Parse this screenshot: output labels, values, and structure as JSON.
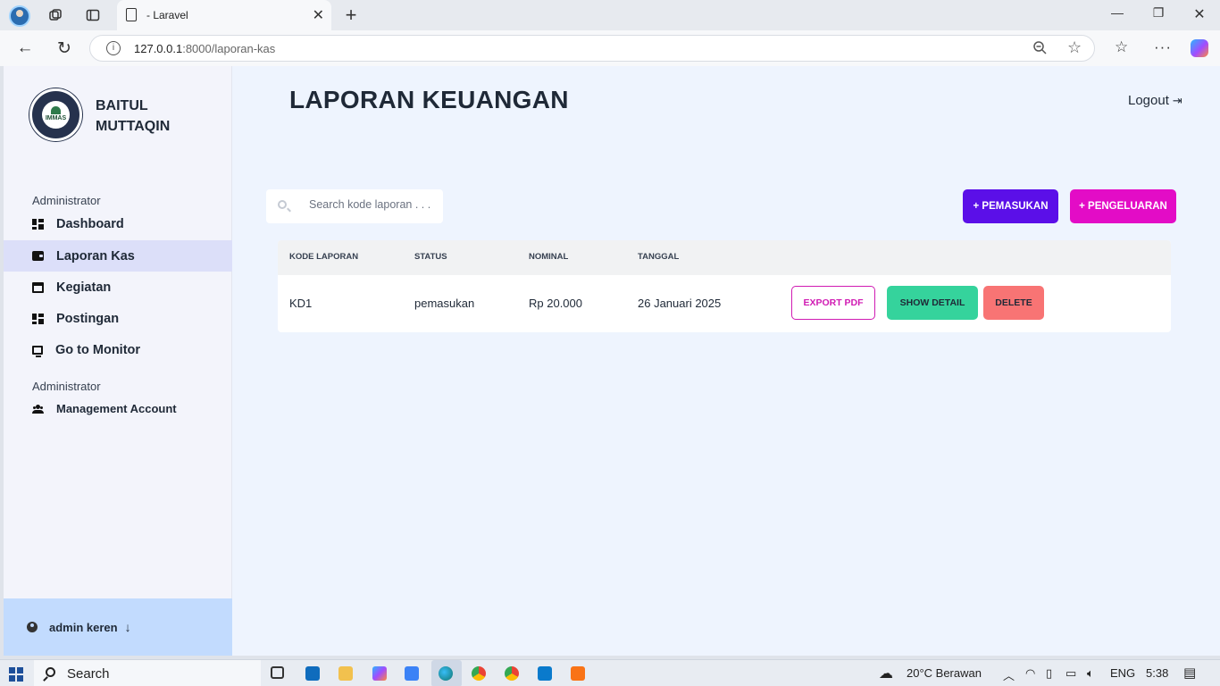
{
  "browser": {
    "tab_title": "- Laravel",
    "url_host": "127.0.0.1",
    "url_rest": ":8000/laporan-kas"
  },
  "sidebar": {
    "brand_line1": "BAITUL",
    "brand_line2": "MUTTAQIN",
    "logo_text": "IMMAS",
    "section1": "Administrator",
    "items": [
      {
        "label": "Dashboard",
        "icon": "dashboard-icon"
      },
      {
        "label": "Laporan Kas",
        "icon": "wallet-icon",
        "active": true
      },
      {
        "label": "Kegiatan",
        "icon": "calendar-icon"
      },
      {
        "label": "Postingan",
        "icon": "dashboard-icon"
      },
      {
        "label": "Go to Monitor",
        "icon": "monitor-icon"
      }
    ],
    "section2": "Administrator",
    "account_item": {
      "label": "Management Account",
      "icon": "users-icon"
    },
    "user_name": "admin keren"
  },
  "header": {
    "title": "LAPORAN KEUANGAN",
    "logout_label": "Logout"
  },
  "toolbar": {
    "search_placeholder": "Search kode laporan . . .",
    "pemasukan_label": "+ PEMASUKAN",
    "pengeluaran_label": "+ PENGELUARAN"
  },
  "table": {
    "headers": [
      "KODE LAPORAN",
      "STATUS",
      "NOMINAL",
      "TANGGAL"
    ],
    "rows": [
      {
        "kode": "KD1",
        "status": "pemasukan",
        "nominal": "Rp 20.000",
        "tanggal": "26 Januari 2025",
        "actions": [
          "EXPORT PDF",
          "SHOW DETAIL",
          "DELETE"
        ]
      }
    ]
  },
  "taskbar": {
    "search_label": "Search",
    "weather": "20°C  Berawan",
    "language": "ENG",
    "time": "5:38"
  },
  "colors": {
    "pemasukan": "#5b0fe8",
    "pengeluaran": "#e30cc6",
    "show_detail": "#35d39c",
    "delete": "#f87474",
    "active_nav": "#dcdff9",
    "user_box": "#c2dbfe"
  }
}
